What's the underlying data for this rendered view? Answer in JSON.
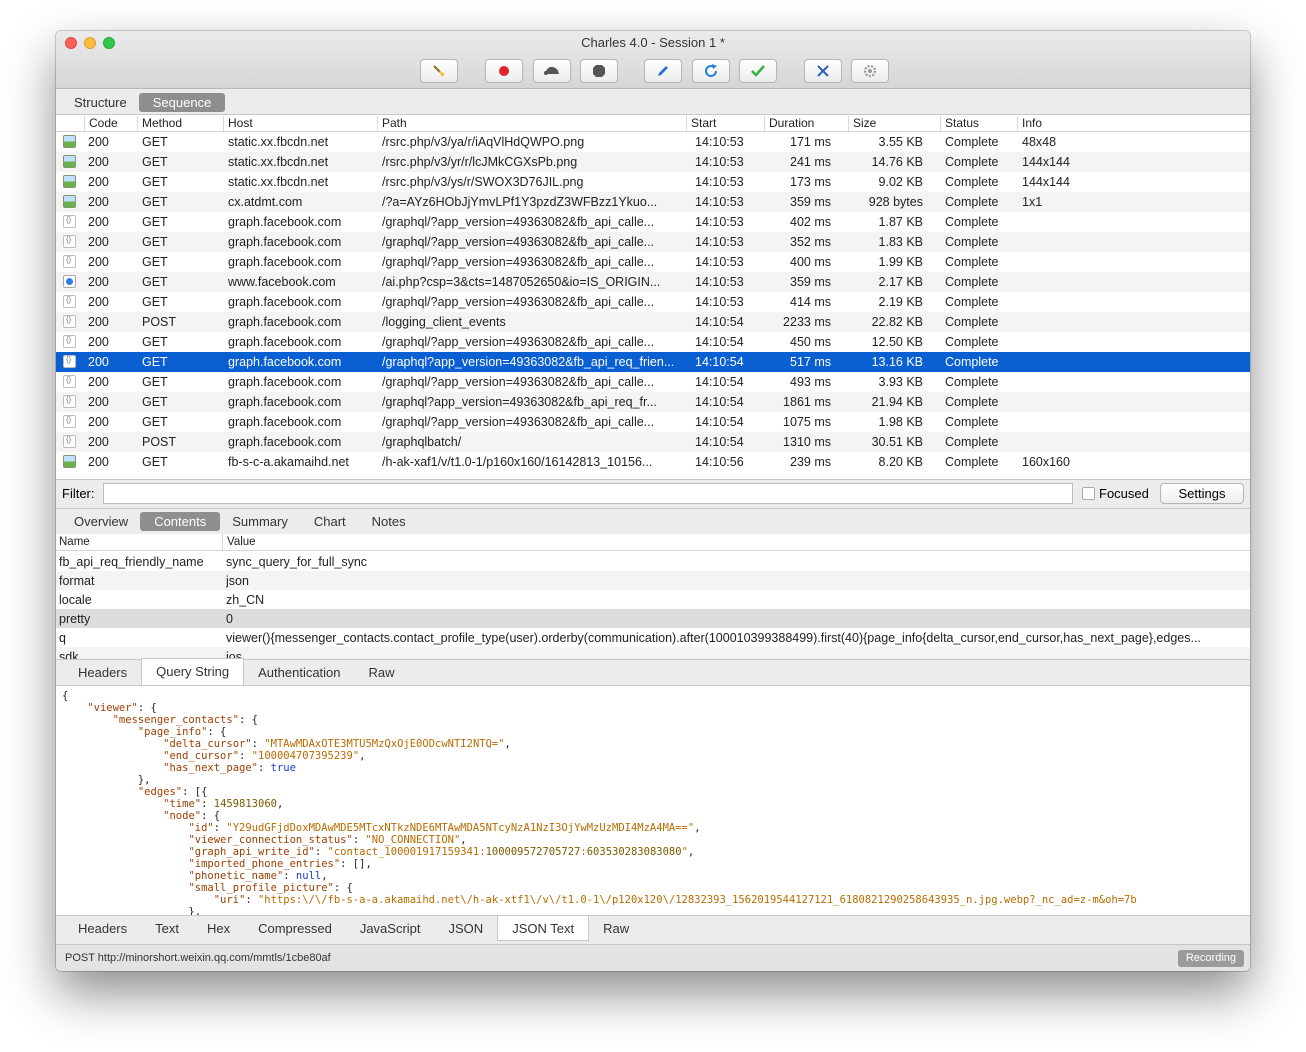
{
  "window": {
    "title": "Charles 4.0 - Session 1 *"
  },
  "toolbar": {
    "items": [
      {
        "icon": "broom-icon",
        "name": "clear-session-button"
      },
      {
        "icon": "record-icon",
        "name": "record-button"
      },
      {
        "icon": "turtle-icon",
        "name": "throttle-button"
      },
      {
        "icon": "stop-sign-icon",
        "name": "breakpoints-button"
      },
      {
        "icon": "pen-icon",
        "name": "compose-button"
      },
      {
        "icon": "refresh-icon",
        "name": "repeat-button"
      },
      {
        "icon": "checkmark-icon",
        "name": "validate-button"
      },
      {
        "icon": "tools-icon",
        "name": "tools-button"
      },
      {
        "icon": "gear-icon",
        "name": "settings-gear-button"
      }
    ]
  },
  "view_tabs": [
    "Structure",
    "Sequence"
  ],
  "columns": [
    "Code",
    "Method",
    "Host",
    "Path",
    "Start",
    "Duration",
    "Size",
    "Status",
    "Info"
  ],
  "rows": [
    {
      "icon": "image",
      "code": "200",
      "method": "GET",
      "host": "static.xx.fbcdn.net",
      "path": "/rsrc.php/v3/ya/r/iAqVlHdQWPO.png",
      "start": "14:10:53",
      "duration": "171 ms",
      "size": "3.55 KB",
      "status": "Complete",
      "info": "48x48"
    },
    {
      "icon": "image",
      "code": "200",
      "method": "GET",
      "host": "static.xx.fbcdn.net",
      "path": "/rsrc.php/v3/yr/r/lcJMkCGXsPb.png",
      "start": "14:10:53",
      "duration": "241 ms",
      "size": "14.76 KB",
      "status": "Complete",
      "info": "144x144"
    },
    {
      "icon": "image",
      "code": "200",
      "method": "GET",
      "host": "static.xx.fbcdn.net",
      "path": "/rsrc.php/v3/ys/r/SWOX3D76JIL.png",
      "start": "14:10:53",
      "duration": "173 ms",
      "size": "9.02 KB",
      "status": "Complete",
      "info": "144x144"
    },
    {
      "icon": "image",
      "code": "200",
      "method": "GET",
      "host": "cx.atdmt.com",
      "path": "/?a=AYz6HObJjYmvLPf1Y3pzdZ3WFBzz1Ykuo...",
      "start": "14:10:53",
      "duration": "359 ms",
      "size": "928 bytes",
      "status": "Complete",
      "info": "1x1"
    },
    {
      "icon": "json",
      "code": "200",
      "method": "GET",
      "host": "graph.facebook.com",
      "path": "/graphql/?app_version=49363082&fb_api_calle...",
      "start": "14:10:53",
      "duration": "402 ms",
      "size": "1.87 KB",
      "status": "Complete",
      "info": ""
    },
    {
      "icon": "json",
      "code": "200",
      "method": "GET",
      "host": "graph.facebook.com",
      "path": "/graphql/?app_version=49363082&fb_api_calle...",
      "start": "14:10:53",
      "duration": "352 ms",
      "size": "1.83 KB",
      "status": "Complete",
      "info": ""
    },
    {
      "icon": "json",
      "code": "200",
      "method": "GET",
      "host": "graph.facebook.com",
      "path": "/graphql/?app_version=49363082&fb_api_calle...",
      "start": "14:10:53",
      "duration": "400 ms",
      "size": "1.99 KB",
      "status": "Complete",
      "info": ""
    },
    {
      "icon": "web",
      "code": "200",
      "method": "GET",
      "host": "www.facebook.com",
      "path": "/ai.php?csp=3&cts=1487052650&io=IS_ORIGIN...",
      "start": "14:10:53",
      "duration": "359 ms",
      "size": "2.17 KB",
      "status": "Complete",
      "info": ""
    },
    {
      "icon": "json",
      "code": "200",
      "method": "GET",
      "host": "graph.facebook.com",
      "path": "/graphql/?app_version=49363082&fb_api_calle...",
      "start": "14:10:53",
      "duration": "414 ms",
      "size": "2.19 KB",
      "status": "Complete",
      "info": ""
    },
    {
      "icon": "json",
      "code": "200",
      "method": "POST",
      "host": "graph.facebook.com",
      "path": "/logging_client_events",
      "start": "14:10:54",
      "duration": "2233 ms",
      "size": "22.82 KB",
      "status": "Complete",
      "info": ""
    },
    {
      "icon": "json",
      "code": "200",
      "method": "GET",
      "host": "graph.facebook.com",
      "path": "/graphql/?app_version=49363082&fb_api_calle...",
      "start": "14:10:54",
      "duration": "450 ms",
      "size": "12.50 KB",
      "status": "Complete",
      "info": ""
    },
    {
      "icon": "json",
      "code": "200",
      "method": "GET",
      "host": "graph.facebook.com",
      "path": "/graphql?app_version=49363082&fb_api_req_frien...",
      "start": "14:10:54",
      "duration": "517 ms",
      "size": "13.16 KB",
      "status": "Complete",
      "info": "",
      "selected": true
    },
    {
      "icon": "json",
      "code": "200",
      "method": "GET",
      "host": "graph.facebook.com",
      "path": "/graphql/?app_version=49363082&fb_api_calle...",
      "start": "14:10:54",
      "duration": "493 ms",
      "size": "3.93 KB",
      "status": "Complete",
      "info": ""
    },
    {
      "icon": "json",
      "code": "200",
      "method": "GET",
      "host": "graph.facebook.com",
      "path": "/graphql?app_version=49363082&fb_api_req_fr...",
      "start": "14:10:54",
      "duration": "1861 ms",
      "size": "21.94 KB",
      "status": "Complete",
      "info": ""
    },
    {
      "icon": "json",
      "code": "200",
      "method": "GET",
      "host": "graph.facebook.com",
      "path": "/graphql/?app_version=49363082&fb_api_calle...",
      "start": "14:10:54",
      "duration": "1075 ms",
      "size": "1.98 KB",
      "status": "Complete",
      "info": ""
    },
    {
      "icon": "json",
      "code": "200",
      "method": "POST",
      "host": "graph.facebook.com",
      "path": "/graphqlbatch/",
      "start": "14:10:54",
      "duration": "1310 ms",
      "size": "30.51 KB",
      "status": "Complete",
      "info": ""
    },
    {
      "icon": "image",
      "code": "200",
      "method": "GET",
      "host": "fb-s-c-a.akamaihd.net",
      "path": "/h-ak-xaf1/v/t1.0-1/p160x160/16142813_10156...",
      "start": "14:10:56",
      "duration": "239 ms",
      "size": "8.20 KB",
      "status": "Complete",
      "info": "160x160"
    }
  ],
  "filter": {
    "label": "Filter:",
    "value": "",
    "focused_label": "Focused",
    "settings_label": "Settings"
  },
  "detail_tabs": [
    "Overview",
    "Contents",
    "Summary",
    "Chart",
    "Notes"
  ],
  "query_table": {
    "columns": [
      "Name",
      "Value"
    ],
    "rows": [
      {
        "name": "fb_api_req_friendly_name",
        "value": "sync_query_for_full_sync"
      },
      {
        "name": "format",
        "value": "json"
      },
      {
        "name": "locale",
        "value": "zh_CN"
      },
      {
        "name": "pretty",
        "value": "0"
      },
      {
        "name": "q",
        "value": "viewer(){messenger_contacts.contact_profile_type(user).orderby(communication).after(100010399388499).first(40){page_info{delta_cursor,end_cursor,has_next_page},edges..."
      },
      {
        "name": "sdk",
        "value": "ios"
      }
    ]
  },
  "request_tabs": [
    "Headers",
    "Query String",
    "Authentication",
    "Raw"
  ],
  "json_lines": [
    "{",
    "    \"viewer\": {",
    "        \"messenger_contacts\": {",
    "            \"page_info\": {",
    "                \"delta_cursor\": \"MTAwMDAxOTE3MTU5MzQxOjE0ODcwNTI2NTQ=\",",
    "                \"end_cursor\": \"100004707395239\",",
    "                \"has_next_page\": true",
    "            },",
    "            \"edges\": [{",
    "                \"time\": 1459813060,",
    "                \"node\": {",
    "                    \"id\": \"Y29udGFjdDoxMDAwMDE5MTcxNTkzNDE6MTAwMDA5NTcyNzA1NzI3OjYwMzUzMDI4MzA4MA==\",",
    "                    \"viewer_connection_status\": \"NO_CONNECTION\",",
    "                    \"graph_api_write_id\": \"contact_100001917159341:100009572705727:603530283083080\",",
    "                    \"imported_phone_entries\": [],",
    "                    \"phonetic_name\": null,",
    "                    \"small_profile_picture\": {",
    "                        \"uri\": \"https:\\/\\/fb-s-a-a.akamaihd.net\\/h-ak-xtf1\\/v\\/t1.0-1\\/p120x120\\/12832393_1562019544127121_6180821290258643935_n.jpg.webp?_nc_ad=z-m&oh=7b",
    "                    },"
  ],
  "response_tabs": [
    "Headers",
    "Text",
    "Hex",
    "Compressed",
    "JavaScript",
    "JSON",
    "JSON Text",
    "Raw"
  ],
  "status_bar": {
    "text": "POST http://minorshort.weixin.qq.com/mmtls/1cbe80af",
    "recording_label": "Recording"
  }
}
